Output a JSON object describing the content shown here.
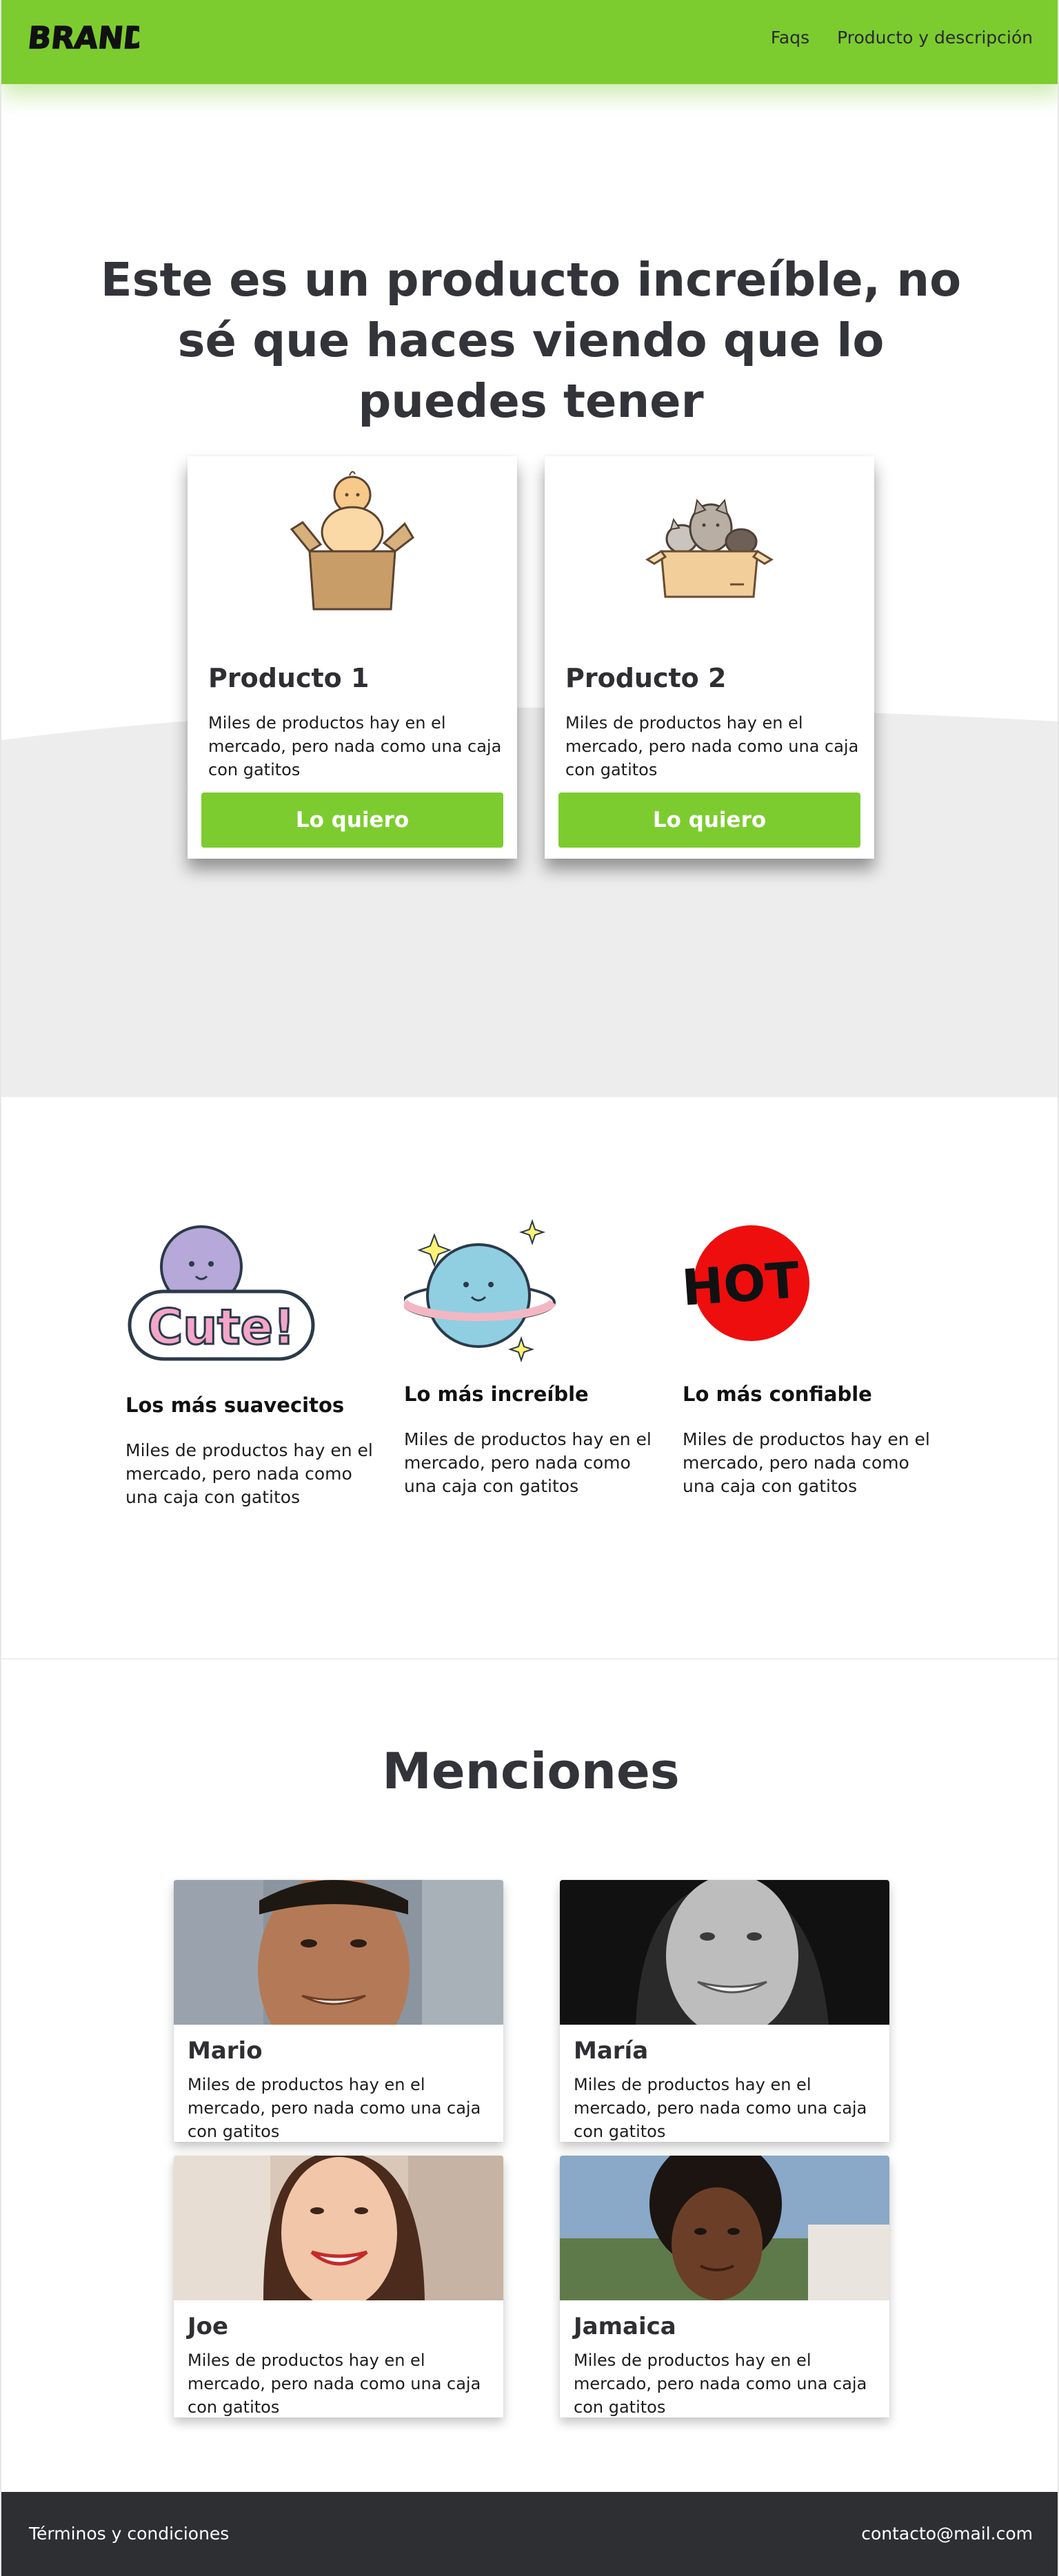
{
  "nav": {
    "brand": "BRAND",
    "links": [
      "Faqs",
      "Producto y descripción"
    ]
  },
  "hero": {
    "title": "Este es un producto increíble, no sé que haces viendo que lo puedes tener",
    "products": [
      {
        "name": "Producto 1",
        "description": "Miles de productos hay en el mercado, pero nada como una caja con gatitos",
        "button": "Lo quiero",
        "icon": "baby-in-box-icon"
      },
      {
        "name": "Producto 2",
        "description": "Miles de productos hay en el mercado, pero nada como una caja con gatitos",
        "button": "Lo quiero",
        "icon": "cats-in-box-icon"
      }
    ]
  },
  "features": [
    {
      "title": "Los más suavecitos",
      "description": "Miles de productos hay en el mercado, pero nada como una caja con gatitos",
      "icon": "cute-sticker-icon",
      "sticker_text": "Cute!"
    },
    {
      "title": "Lo más increíble",
      "description": "Miles de productos hay en el mercado, pero nada como una caja con gatitos",
      "icon": "planet-icon"
    },
    {
      "title": "Lo más confiable",
      "description": "Miles de productos hay en el mercado, pero nada como una caja con gatitos",
      "icon": "hot-sticker-icon",
      "sticker_text": "HOT"
    }
  ],
  "mentions": {
    "title": "Menciones",
    "people": [
      {
        "name": "Mario",
        "description": "Miles de productos hay en el mercado, pero nada como una caja con gatitos"
      },
      {
        "name": "María",
        "description": "Miles de productos hay en el mercado, pero nada como una caja con gatitos"
      },
      {
        "name": "Joe",
        "description": "Miles de productos hay en el mercado, pero nada como una caja con gatitos"
      },
      {
        "name": "Jamaica",
        "description": "Miles de productos hay en el mercado, pero nada como una caja con gatitos"
      }
    ]
  },
  "footer": {
    "terms": "Términos y condiciones",
    "contact": "contacto@mail.com"
  },
  "colors": {
    "accent": "#7ccc2f",
    "footer": "#2e2f33",
    "wave": "#ededed"
  }
}
